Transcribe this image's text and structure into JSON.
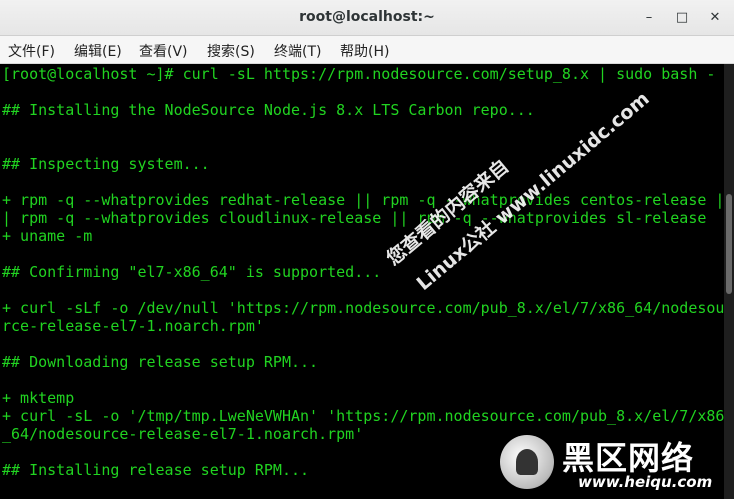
{
  "window": {
    "title": "root@localhost:~",
    "minimize_glyph": "–",
    "maximize_glyph": "□",
    "close_glyph": "✕"
  },
  "menu": [
    {
      "label": "文件(F)"
    },
    {
      "label": "编辑(E)"
    },
    {
      "label": "查看(V)"
    },
    {
      "label": "搜索(S)"
    },
    {
      "label": "终端(T)"
    },
    {
      "label": "帮助(H)"
    }
  ],
  "terminal": {
    "lines": [
      "[root@localhost ~]# curl -sL https://rpm.nodesource.com/setup_8.x | sudo bash -",
      "",
      "## Installing the NodeSource Node.js 8.x LTS Carbon repo...",
      "",
      "",
      "## Inspecting system...",
      "",
      "+ rpm -q --whatprovides redhat-release || rpm -q --whatprovides centos-release |",
      "| rpm -q --whatprovides cloudlinux-release || rpm -q --whatprovides sl-release",
      "+ uname -m",
      "",
      "## Confirming \"el7-x86_64\" is supported...",
      "",
      "+ curl -sLf -o /dev/null 'https://rpm.nodesource.com/pub_8.x/el/7/x86_64/nodesou",
      "rce-release-el7-1.noarch.rpm'",
      "",
      "## Downloading release setup RPM...",
      "",
      "+ mktemp",
      "+ curl -sL -o '/tmp/tmp.LweNeVWHAn' 'https://rpm.nodesource.com/pub_8.x/el/7/x86",
      "_64/nodesource-release-el7-1.noarch.rpm'",
      "",
      "## Installing release setup RPM..."
    ],
    "text_color": "#21d321",
    "background": "#000000"
  },
  "watermark": {
    "line1": "您查看的内容来自",
    "line2": "Linux公社 www.linuxidc.com"
  },
  "logo": {
    "name": "黑区网络",
    "url": "www.heiqu.com"
  }
}
